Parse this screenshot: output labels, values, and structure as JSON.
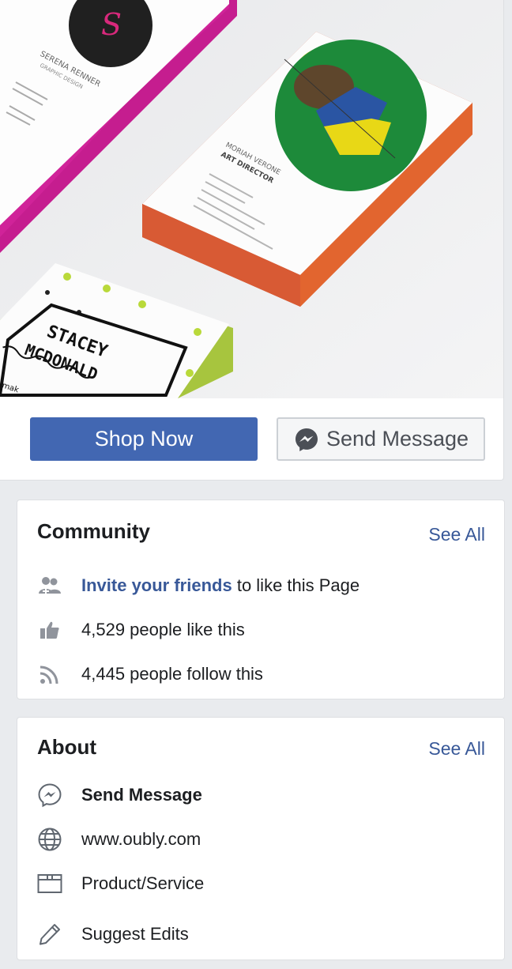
{
  "buttons": {
    "shop_now": "Shop Now",
    "send_message": "Send Message"
  },
  "community": {
    "title": "Community",
    "see_all": "See All",
    "invite_link": "Invite your friends",
    "invite_rest": " to like this Page",
    "likes": "4,529 people like this",
    "follows": "4,445 people follow this",
    "icons": [
      "friends-icon",
      "thumbs-up-icon",
      "rss-icon"
    ]
  },
  "about": {
    "title": "About",
    "see_all": "See All",
    "items": [
      {
        "icon": "messenger-icon",
        "label": "Send Message"
      },
      {
        "icon": "globe-icon",
        "label": "www.oubly.com"
      },
      {
        "icon": "storefront-icon",
        "label": "Product/Service"
      },
      {
        "icon": "pencil-icon",
        "label": "Suggest Edits"
      }
    ]
  },
  "cover_cards": {
    "card1_name": "SERENA RENNER",
    "card1_role": "GRAPHIC DESIGN",
    "card1_initial": "S",
    "card2_name": "MORIAH VERONE",
    "card2_role": "ART DIRECTOR",
    "card3_name_line1": "STACEY",
    "card3_name_line2": "MCDONALD",
    "card3_tag": "mak"
  },
  "colors": {
    "primary": "#4267b2",
    "link": "#385898",
    "background": "#e9ebee",
    "text": "#1c1e21"
  }
}
